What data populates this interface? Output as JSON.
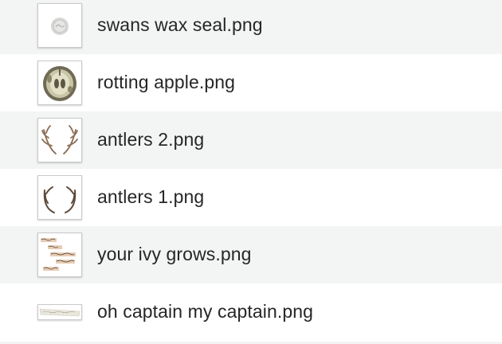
{
  "files": [
    {
      "name": "swans wax seal.png",
      "thumbnail_icon": "wax-seal-thumbnail",
      "striped": true
    },
    {
      "name": "rotting apple.png",
      "thumbnail_icon": "apple-thumbnail",
      "striped": false
    },
    {
      "name": "antlers 2.png",
      "thumbnail_icon": "antlers-thumbnail",
      "striped": true
    },
    {
      "name": "antlers 1.png",
      "thumbnail_icon": "antlers-thumbnail",
      "striped": false
    },
    {
      "name": "your ivy grows.png",
      "thumbnail_icon": "handwritten-note-thumbnail",
      "striped": true
    },
    {
      "name": "oh captain my captain.png",
      "thumbnail_icon": "paper-strip-thumbnail",
      "striped": false
    }
  ],
  "colors": {
    "stripe": "#f3f4f4",
    "text": "#262626",
    "background": "#ffffff"
  }
}
